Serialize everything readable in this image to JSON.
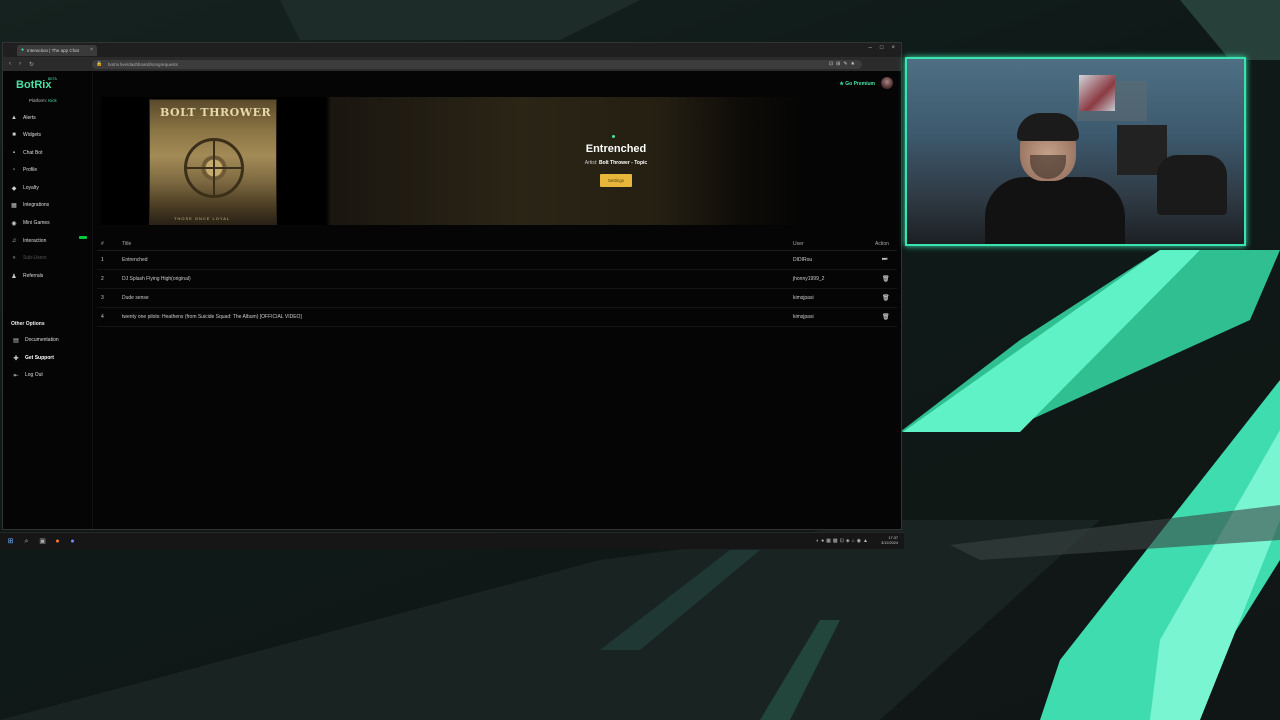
{
  "browser": {
    "tab_title": "Interaction | The app Chat",
    "url": "botrix.live/dashboard/songrequests",
    "nav_icons": [
      "back-icon",
      "forward-icon",
      "reload-icon"
    ]
  },
  "sidebar": {
    "logo": "BotRix",
    "beta": "BETA",
    "platform_label": "Platform:",
    "platform_value": "Kick",
    "items": [
      {
        "label": "Alerts",
        "icon": "alert-icon"
      },
      {
        "label": "Widgets",
        "icon": "widget-icon"
      },
      {
        "label": "Chat Bot",
        "icon": "chat-icon"
      },
      {
        "label": "Profile",
        "icon": "profile-icon"
      },
      {
        "label": "Loyalty",
        "icon": "loyalty-icon"
      },
      {
        "label": "Integrations",
        "icon": "integrations-icon"
      },
      {
        "label": "Mini Games",
        "icon": "games-icon"
      },
      {
        "label": "Interaction",
        "icon": "music-icon"
      },
      {
        "label": "Sub-Users",
        "icon": "users-icon"
      },
      {
        "label": "Referrals",
        "icon": "referrals-icon"
      }
    ],
    "other_title": "Other Options",
    "other_items": [
      {
        "label": "Documentation",
        "icon": "docs-icon"
      },
      {
        "label": "Get Support",
        "icon": "support-icon"
      },
      {
        "label": "Log Out",
        "icon": "logout-icon"
      }
    ]
  },
  "header": {
    "premium": "Go Premium"
  },
  "now_playing": {
    "title": "Entrenched",
    "artist_label": "Artist:",
    "artist": "Bolt Thrower - Topic",
    "settings_button": "Settings",
    "album_band": "BOLT THROWER",
    "album_footer": "THOSE ONCE LOYAL"
  },
  "queue": {
    "columns": [
      "#",
      "Title",
      "User",
      "Action"
    ],
    "rows": [
      {
        "num": "1",
        "title": "Entrenched",
        "user": "DIDIRou",
        "action_icon": "skip-icon"
      },
      {
        "num": "2",
        "title": "DJ Splash Flying High(original)",
        "user": "jhonny1999_2",
        "action_icon": "trash-icon"
      },
      {
        "num": "3",
        "title": "Dude sense",
        "user": "kimsjpasi",
        "action_icon": "trash-icon"
      },
      {
        "num": "4",
        "title": "twenty one pilots: Heathens (from Suicide Squad: The Album) [OFFICIAL VIDEO]",
        "user": "kimsjpasi",
        "action_icon": "trash-icon"
      }
    ]
  },
  "taskbar": {
    "clock_time": "17:37",
    "clock_date": "3/12/2024"
  },
  "colors": {
    "accent": "#49e3a7",
    "settings_button": "#e7b63a",
    "webcam_border": "#3be3b0"
  }
}
